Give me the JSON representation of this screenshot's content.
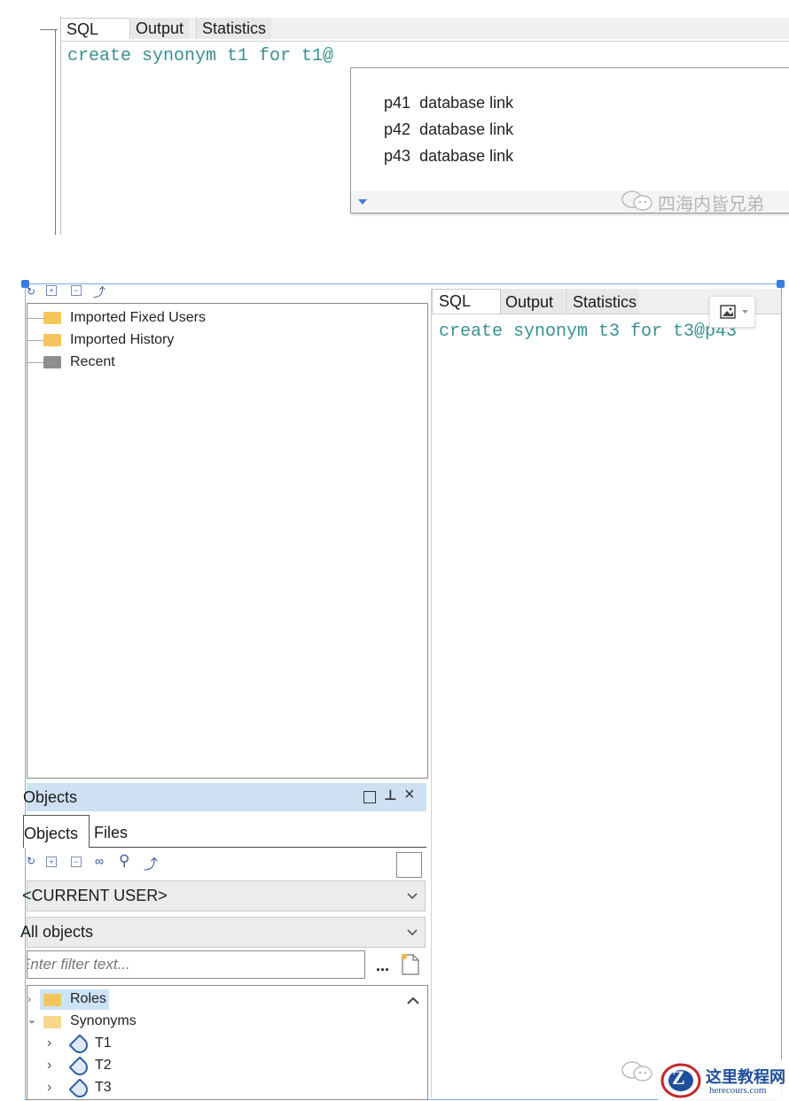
{
  "top": {
    "tabs": [
      "SQL",
      "Output",
      "Statistics"
    ],
    "sql_text": "create synonym t1 for t1@",
    "completions": [
      {
        "name": "p41",
        "kind": "database link"
      },
      {
        "name": "p42",
        "kind": "database link"
      },
      {
        "name": "p43",
        "kind": "database link"
      }
    ],
    "watermark": "四海内皆兄弟",
    "watermark_icon": "wechat-icon"
  },
  "bottom": {
    "tree": {
      "items": [
        {
          "label": "Imported Fixed Users",
          "icon": "folder-icon"
        },
        {
          "label": "Imported History",
          "icon": "folder-icon"
        },
        {
          "label": "Recent",
          "icon": "folder-icon-gray"
        }
      ]
    },
    "editor": {
      "tabs": [
        "SQL",
        "Output",
        "Statistics"
      ],
      "sql_text": "create synonym t3 for t3@p43",
      "image_button_icon": "image-icon"
    },
    "objects_panel": {
      "title": "Objects",
      "tabs": [
        "Objects",
        "Files"
      ],
      "owner": "<CURRENT USER>",
      "filter_scope": "All objects",
      "filter_placeholder": "Enter filter text...",
      "ellipsis_label": "...",
      "tree": [
        {
          "label": "Roles"
        },
        {
          "label": "Synonyms"
        },
        {
          "label": "T1"
        },
        {
          "label": "T2"
        },
        {
          "label": "T3"
        }
      ]
    },
    "logo": {
      "main": "这里教程网",
      "sub": "herecours.com",
      "letter": "Z"
    }
  },
  "colors": {
    "sql_keyword": "#3a9090",
    "selection": "#3b7ddd",
    "panel_header": "#cfe0f3",
    "folder": "#f5c65c"
  }
}
